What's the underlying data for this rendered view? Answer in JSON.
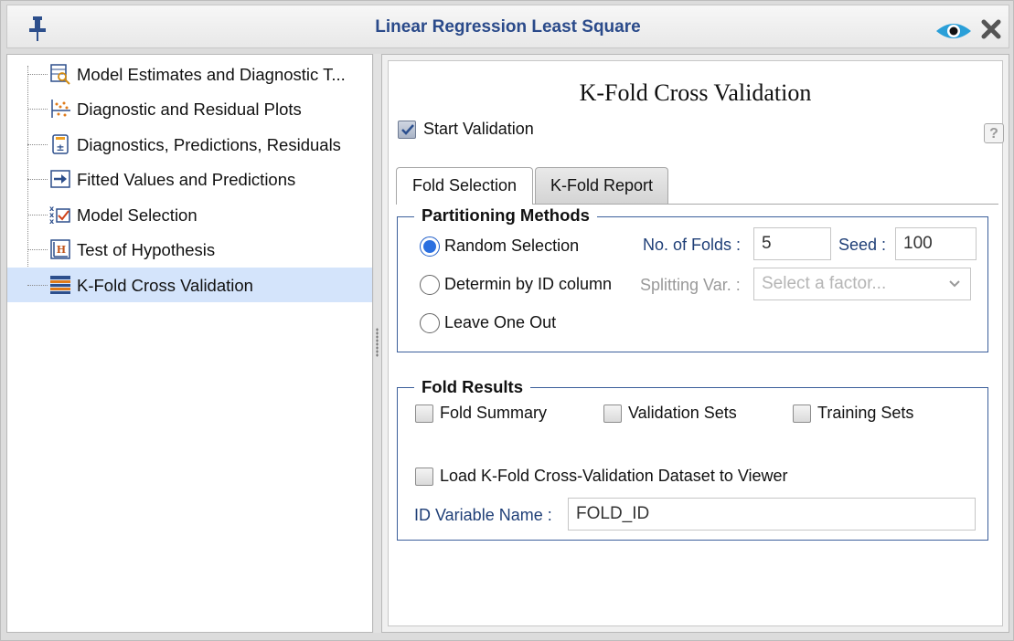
{
  "window": {
    "title": "Linear Regression Least Square"
  },
  "icons": {
    "pin": "pin-icon",
    "visibility": "eye-icon",
    "close": "close-icon"
  },
  "tree": {
    "items": [
      {
        "label": "Model Estimates and Diagnostic T...",
        "icon": "table-search-icon",
        "selected": false
      },
      {
        "label": "Diagnostic and Residual Plots",
        "icon": "scatter-plot-icon",
        "selected": false
      },
      {
        "label": "Diagnostics, Predictions, Residuals",
        "icon": "calculator-icon",
        "selected": false
      },
      {
        "label": "Fitted Values and Predictions",
        "icon": "arrow-right-icon",
        "selected": false
      },
      {
        "label": "Model Selection",
        "icon": "variable-selection-icon",
        "selected": false
      },
      {
        "label": "Test of Hypothesis",
        "icon": "hypothesis-icon",
        "selected": false
      },
      {
        "label": "K-Fold Cross Validation",
        "icon": "kfold-icon",
        "selected": true
      }
    ]
  },
  "panel": {
    "title": "K-Fold Cross Validation",
    "start_validation_label": "Start Validation",
    "start_validation_checked": true,
    "help_label": "?"
  },
  "tabs": [
    {
      "label": "Fold Selection",
      "active": true
    },
    {
      "label": "K-Fold Report",
      "active": false
    }
  ],
  "partitioning": {
    "legend": "Partitioning Methods",
    "options": [
      {
        "label": "Random Selection",
        "selected": true
      },
      {
        "label": "Determin by ID column",
        "selected": false
      },
      {
        "label": "Leave One Out",
        "selected": false
      }
    ],
    "folds_label": "No. of Folds :",
    "folds_value": "5",
    "seed_label": "Seed :",
    "seed_value": "100",
    "splitting_label": "Splitting Var. :",
    "splitting_placeholder": "Select a factor..."
  },
  "fold_results": {
    "legend": "Fold Results",
    "fold_summary_label": "Fold Summary",
    "validation_sets_label": "Validation Sets",
    "training_sets_label": "Training Sets",
    "load_dataset_label": "Load K-Fold Cross-Validation Dataset to Viewer",
    "id_variable_label": "ID Variable Name :",
    "id_variable_value": "FOLD_ID"
  }
}
